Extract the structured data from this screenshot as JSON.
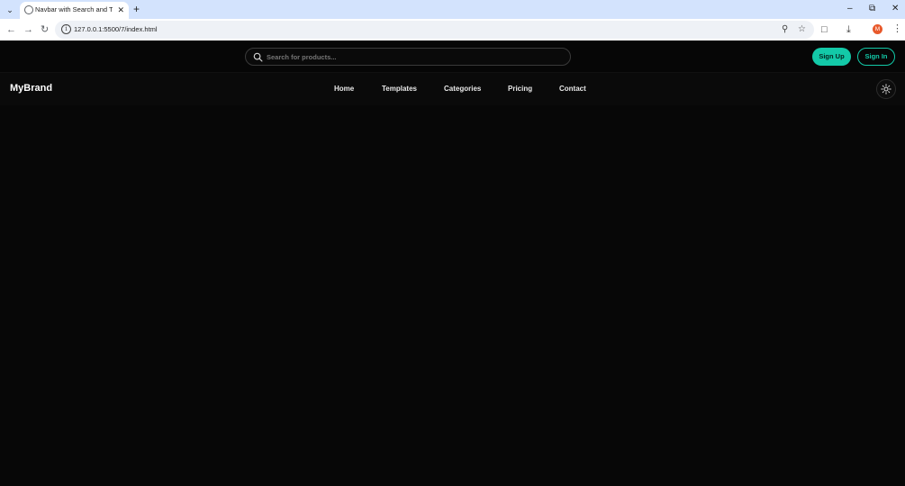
{
  "browser": {
    "tab_title": "Navbar with Search and Theme",
    "url": "127.0.0.1:5500/7/index.html",
    "avatar_initial": "M"
  },
  "page": {
    "search": {
      "placeholder": "Search for products..."
    },
    "auth": {
      "signup_label": "Sign Up",
      "signin_label": "Sign In"
    },
    "brand": "MyBrand",
    "nav": [
      "Home",
      "Templates",
      "Categories",
      "Pricing",
      "Contact"
    ],
    "colors": {
      "accent": "#13c9a8",
      "background": "#070707"
    },
    "theme_toggle_icon": "sun-icon"
  }
}
